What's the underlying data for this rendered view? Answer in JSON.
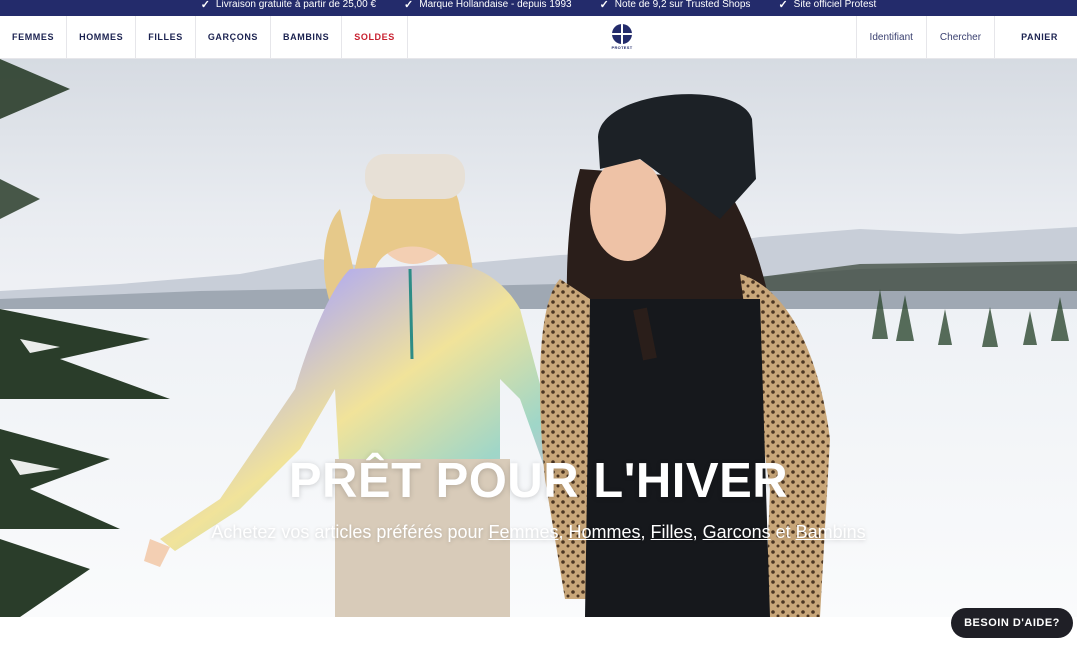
{
  "announcements": [
    "Livraison gratuite à partir de 25,00 €",
    "Marque Hollandaise - depuis 1993",
    "Note de 9,2 sur Trusted Shops",
    "Site officiel Protest"
  ],
  "nav": {
    "items": [
      "FEMMES",
      "HOMMES",
      "FILLES",
      "GARÇONS",
      "BAMBINS",
      "SOLDES"
    ],
    "logo_text": "PROTEST",
    "account": "Identifiant",
    "search": "Chercher",
    "cart": "PANIER"
  },
  "hero": {
    "title": "PRÊT POUR L'HIVER",
    "subtitle_prefix": "Achetez vos articles préférés pour ",
    "links": [
      "Femmes",
      "Hommes",
      "Filles",
      "Garcons",
      "Bambins"
    ],
    "sep1": ", ",
    "sep2": ", ",
    "sep3": ", ",
    "sep_last": " et "
  },
  "help_button": "BESOIN D'AIDE?",
  "colors": {
    "brand": "#232b6b",
    "sale": "#c8202f",
    "help_bg": "#1f1f26"
  }
}
